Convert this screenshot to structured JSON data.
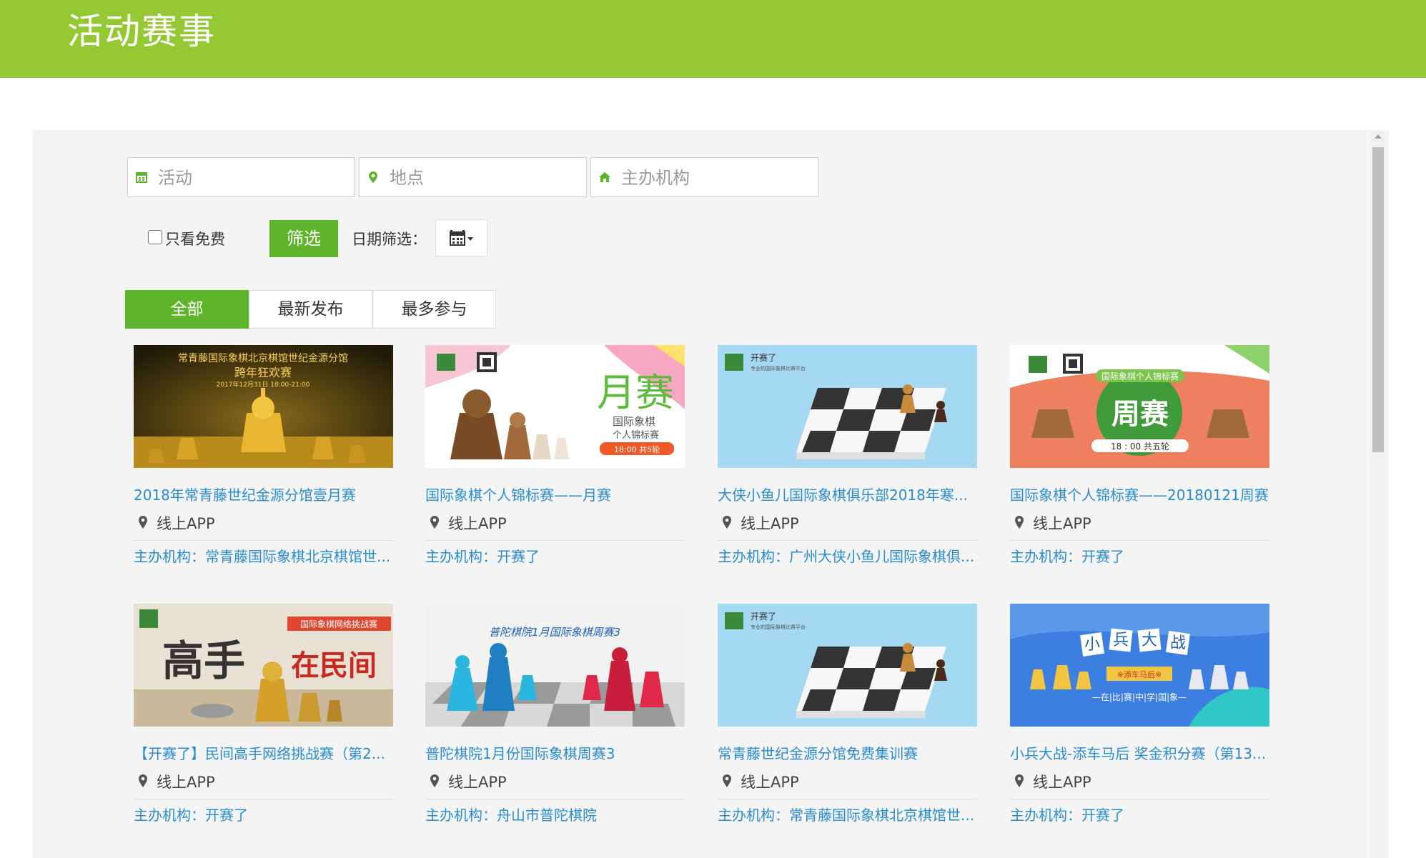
{
  "header": {
    "title": "活动赛事"
  },
  "search": {
    "activity_placeholder": "活动",
    "location_placeholder": "地点",
    "organizer_placeholder": "主办机构"
  },
  "filter": {
    "free_only_label": "只看免费",
    "filter_button": "筛选",
    "date_label": "日期筛选："
  },
  "tabs": [
    "全部",
    "最新发布",
    "最多参与"
  ],
  "events": [
    {
      "name": "2018年常青藤世纪金源分馆壹月赛",
      "location": "线上APP",
      "organizer": "主办机构：常青藤国际象棋北京棋馆世...",
      "banner": [
        "常青藤国际象棋北京棋馆世纪金源分馆",
        "跨年狂欢赛",
        "2017年12月31日 18:00-21:00"
      ]
    },
    {
      "name": "国际象棋个人锦标赛——月赛",
      "location": "线上APP",
      "organizer": "主办机构：开赛了",
      "banner": [
        "月赛",
        "国际象棋",
        "个人锦标赛",
        "18:00 共5轮"
      ]
    },
    {
      "name": "大侠小鱼儿国际象棋俱乐部2018年寒...",
      "location": "线上APP",
      "organizer": "主办机构：广州大侠小鱼儿国际象棋俱...",
      "banner": [
        "开赛了",
        "专业的国际象棋比赛平台"
      ]
    },
    {
      "name": "国际象棋个人锦标赛——20180121周赛",
      "location": "线上APP",
      "organizer": "主办机构：开赛了",
      "banner": [
        "国际象棋个人锦标赛",
        "周赛",
        "18 : 00  共五轮"
      ]
    },
    {
      "name": "【开赛了】民间高手网络挑战赛（第2...",
      "location": "线上APP",
      "organizer": "主办机构：开赛了",
      "banner": [
        "国际象棋网络挑战赛",
        "高手",
        "在民间"
      ]
    },
    {
      "name": "普陀棋院1月份国际象棋周赛3",
      "location": "线上APP",
      "organizer": "主办机构：舟山市普陀棋院",
      "banner": [
        "普陀棋院1月国际象棋周赛3"
      ]
    },
    {
      "name": "常青藤世纪金源分馆免费集训赛",
      "location": "线上APP",
      "organizer": "主办机构：常青藤国际象棋北京棋馆世...",
      "banner": [
        "开赛了",
        "专业的国际象棋比赛平台"
      ]
    },
    {
      "name": "小兵大战-添车马后 奖金积分赛（第13...",
      "location": "线上APP",
      "organizer": "主办机构：开赛了",
      "banner": [
        "小",
        "兵",
        "大",
        "战",
        "※添车马后※",
        "—在|比|赛|中|学|国|象—"
      ]
    }
  ],
  "colors": {
    "brand_green": "#95c934",
    "button_green": "#5eb52c",
    "link_blue": "#2a8cd0"
  },
  "icons": [
    "calendar-icon",
    "map-marker-icon",
    "home-icon",
    "calendar-dropdown-icon",
    "location-pin-icon"
  ]
}
